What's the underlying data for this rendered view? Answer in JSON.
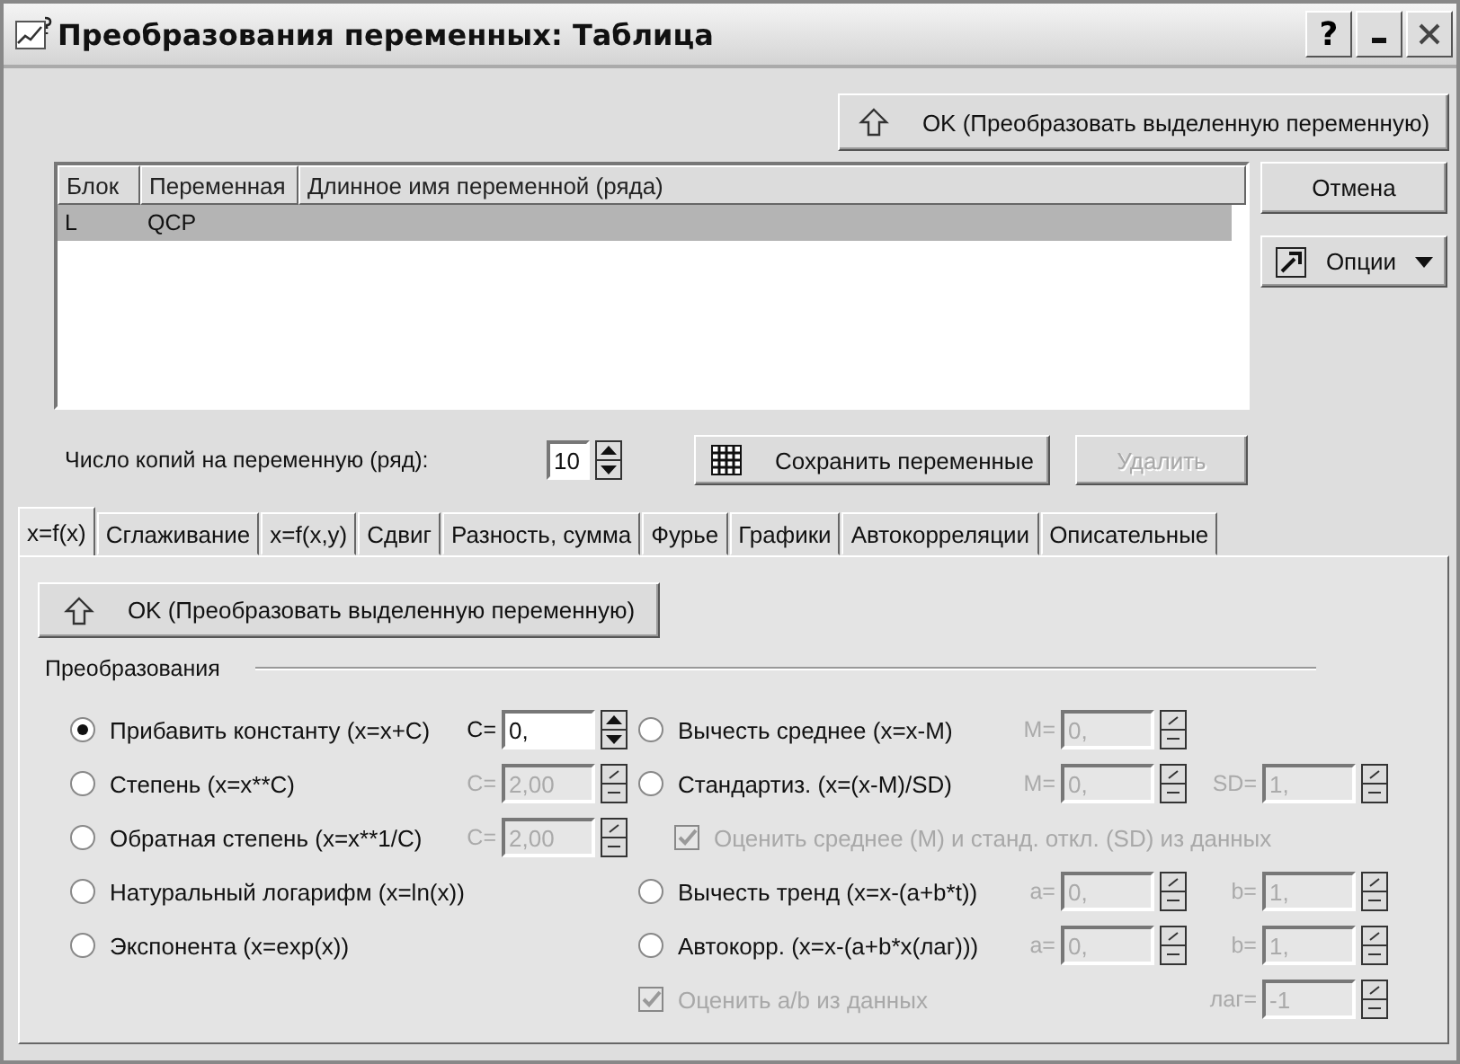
{
  "window": {
    "title": "Преобразования переменных: Таблица",
    "help": "?"
  },
  "ok_button": "OK (Преобразовать выделенную переменную)",
  "table": {
    "columns": [
      "Блок",
      "Переменная",
      "Длинное имя переменной (ряда)"
    ],
    "rows": [
      {
        "block": "L",
        "variable": "QCP",
        "selected": true
      }
    ]
  },
  "side_buttons": {
    "cancel": "Отмена",
    "options": "Опции"
  },
  "copies": {
    "label": "Число копий на переменную (ряд):",
    "value": "10"
  },
  "save_button": {
    "label": "Сохранить переменные",
    "disabled": false
  },
  "delete_button": {
    "label": "Удалить",
    "disabled": true
  },
  "tabs": [
    {
      "label": "x=f(x)",
      "selected": true
    },
    {
      "label": "Сглаживание",
      "selected": false
    },
    {
      "label": "x=f(x,y)",
      "selected": false
    },
    {
      "label": "Сдвиг",
      "selected": false
    },
    {
      "label": "Разность, сумма",
      "selected": false
    },
    {
      "label": "Фурье",
      "selected": false
    },
    {
      "label": "Графики",
      "selected": false
    },
    {
      "label": "Автокорреляции",
      "selected": false
    },
    {
      "label": "Описательные",
      "selected": false
    }
  ],
  "panel": {
    "ok_button": "OK (Преобразовать выделенную переменную)",
    "group_title": "Преобразования",
    "left": [
      {
        "kind": "radio",
        "label": "Прибавить константу (x=x+C)",
        "selected": true,
        "fields": [
          {
            "label": "C=",
            "value": "0,",
            "disabled": false
          }
        ]
      },
      {
        "kind": "radio",
        "label": "Степень (x=x**C)",
        "selected": false,
        "fields": [
          {
            "label": "C=",
            "value": "2,00",
            "disabled": true
          }
        ]
      },
      {
        "kind": "radio",
        "label": "Обратная степень (x=x**1/C)",
        "selected": false,
        "fields": [
          {
            "label": "C=",
            "value": "2,00",
            "disabled": true
          }
        ]
      },
      {
        "kind": "radio",
        "label": "Натуральный логарифм (x=ln(x))",
        "selected": false
      },
      {
        "kind": "radio",
        "label": "Экспонента (x=exp(x))",
        "selected": false
      }
    ],
    "right": [
      {
        "kind": "radio",
        "label": "Вычесть среднее (x=x-M)",
        "selected": false,
        "fields": [
          {
            "label": "M=",
            "value": "0,",
            "disabled": true
          }
        ]
      },
      {
        "kind": "radio",
        "label": "Стандартиз. (x=(x-M)/SD)",
        "selected": false,
        "fields": [
          {
            "label": "M=",
            "value": "0,",
            "disabled": true
          },
          {
            "label": "SD=",
            "value": "1,",
            "disabled": true
          }
        ],
        "children": [
          {
            "kind": "checkbox",
            "label": "Оценить среднее (M) и станд. откл. (SD) из данных",
            "checked": true,
            "disabled": true
          }
        ]
      },
      {
        "kind": "radio",
        "label": "Вычесть тренд (x=x-(a+b*t))",
        "selected": false,
        "fields": [
          {
            "label": "a=",
            "value": "0,",
            "disabled": true
          },
          {
            "label": "b=",
            "value": "1,",
            "disabled": true
          }
        ]
      },
      {
        "kind": "radio",
        "label": "Автокорр. (x=x-(a+b*x(лаг)))",
        "selected": false,
        "fields": [
          {
            "label": "a=",
            "value": "0,",
            "disabled": true
          },
          {
            "label": "b=",
            "value": "1,",
            "disabled": true
          }
        ]
      },
      {
        "kind": "checkbox",
        "label": "Оценить a/b из данных",
        "checked": true,
        "disabled": true,
        "fields": [
          {
            "label": "лаг=",
            "value": "-1",
            "disabled": true
          }
        ]
      }
    ]
  }
}
